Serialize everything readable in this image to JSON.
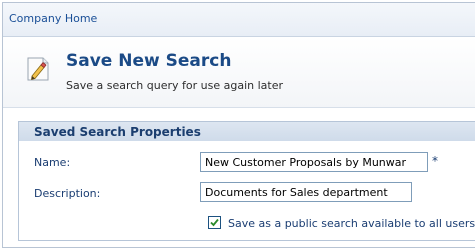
{
  "breadcrumb": {
    "home_label": "Company Home"
  },
  "header": {
    "title": "Save New Search",
    "subtitle": "Save a search query for use again later",
    "icon": "pencil-icon"
  },
  "properties": {
    "section_title": "Saved Search Properties",
    "name_label": "Name:",
    "name_value": "New Customer Proposals by Munwar",
    "required_marker": "*",
    "description_label": "Description:",
    "description_value": "Documents for Sales department",
    "public_label": "Save as a public search available to all users.",
    "public_checked": true
  },
  "colors": {
    "title": "#1b4a86",
    "label": "#1a3d72",
    "panel_header": "#dde6f1",
    "border": "#b6c5d8",
    "check": "#2a8a2a"
  }
}
